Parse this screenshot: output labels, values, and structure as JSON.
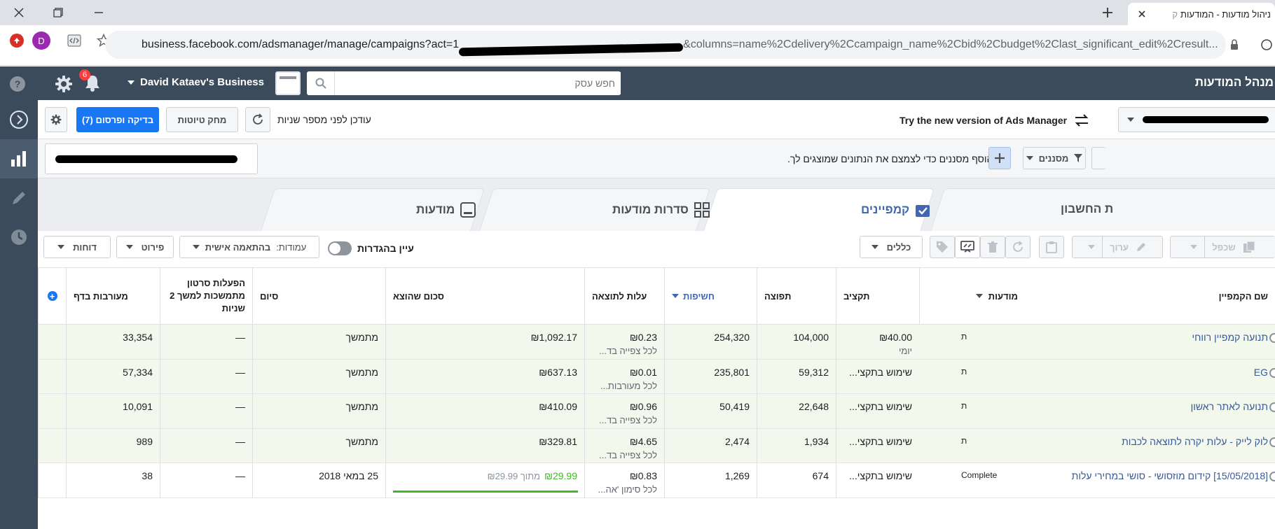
{
  "browser": {
    "tab_title": "ניהול מודעות - המודעות",
    "tab_prefix": "ק",
    "url": "business.facebook.com/adsmanager/manage/campaigns?act=1",
    "url_tail": "&columns=name%2Cdelivery%2Ccampaign_name%2Cbid%2Cbudget%2Clast_significant_edit%2Cresult...",
    "profile_initial": "D"
  },
  "topbar": {
    "app_title": "מנהל המודעות",
    "business_name": "David Kataev's Business",
    "search_placeholder": "חפש עסק",
    "notif_count": "6"
  },
  "toolbar1": {
    "new_version": "Try the new version of Ads Manager",
    "updated": "עודכן לפני מספר שניות",
    "discard": "מחק טיוטות",
    "review": "בדיקה ופרסום (7)"
  },
  "toolbar2": {
    "filters": "מסננים",
    "filter_hint": "הוסף מסננים כדי לצמצם את הנתונים שמוצגים לך."
  },
  "tabs": {
    "account": "ת החשבון",
    "campaigns": "קמפיינים",
    "adsets": "סדרות מודעות",
    "ads": "מודעות"
  },
  "actions": {
    "duplicate": "שכפל",
    "edit": "ערוך",
    "rules": "כללים",
    "view_settings": "עיין בהגדרות",
    "columns_label": "עמודות:",
    "columns_value": "בהתאמה אישית",
    "breakdown": "פירוט",
    "reports": "דוחות"
  },
  "table": {
    "headers": {
      "name": "שם הקמפיין",
      "delivery": "מודעות",
      "budget": "תקציב",
      "reach": "תפוצה",
      "impressions": "חשיפות",
      "cost": "עלות לתוצאה",
      "spent": "סכום שהוצא",
      "ends": "סיום",
      "video": "הפעלות סרטון מתמשכות למשך 2 שניות",
      "engagement": "מעורבות בדף"
    },
    "rows": [
      {
        "name": "תנועה קמפיין רווחי",
        "delivery": "ת",
        "budget": "₪40.00",
        "budget_sub": "יומי",
        "reach": "104,000",
        "impressions": "254,320",
        "cost": "₪0.23",
        "cost_sub": "לכל צפייה בד...",
        "spent": "₪1,092.17",
        "ends": "מתמשך",
        "video": "—",
        "engagement": "33,354"
      },
      {
        "name": "EG",
        "delivery": "ת",
        "budget": "שימוש בתקצי...",
        "budget_sub": "",
        "reach": "59,312",
        "impressions": "235,801",
        "cost": "₪0.01",
        "cost_sub": "לכל מעורבות...",
        "spent": "₪637.13",
        "ends": "מתמשך",
        "video": "—",
        "engagement": "57,334"
      },
      {
        "name": "תנועה לאתר ראשון",
        "delivery": "ת",
        "budget": "שימוש בתקצי...",
        "budget_sub": "",
        "reach": "22,648",
        "impressions": "50,419",
        "cost": "₪0.96",
        "cost_sub": "לכל צפייה בד...",
        "spent": "₪410.09",
        "ends": "מתמשך",
        "video": "—",
        "engagement": "10,091"
      },
      {
        "name": "לוק לייק - עלות יקרה לתוצאה לכבות",
        "delivery": "ת",
        "budget": "שימוש בתקצי...",
        "budget_sub": "",
        "reach": "1,934",
        "impressions": "2,474",
        "cost": "₪4.65",
        "cost_sub": "לכל צפייה בד...",
        "spent": "₪329.81",
        "ends": "מתמשך",
        "video": "—",
        "engagement": "989"
      },
      {
        "name": "[15/05/2018] קידום מוזסושי - סושי במחירי עלות",
        "delivery": "Complete",
        "budget": "שימוש בתקצי...",
        "budget_sub": "",
        "reach": "674",
        "impressions": "1,269",
        "cost": "₪0.83",
        "cost_sub": "לכל סימון 'אה...",
        "spent": "₪29.99",
        "spent_of": "מתוך ₪29.99",
        "spent_progress": 1.0,
        "ends": "25 במאי 2018",
        "video": "—",
        "engagement": "38"
      }
    ]
  },
  "colors": {
    "accent": "#4267b2",
    "topbar": "#3b4b5b",
    "progress": "#42b72a",
    "row_active": "#f2f9ec"
  }
}
